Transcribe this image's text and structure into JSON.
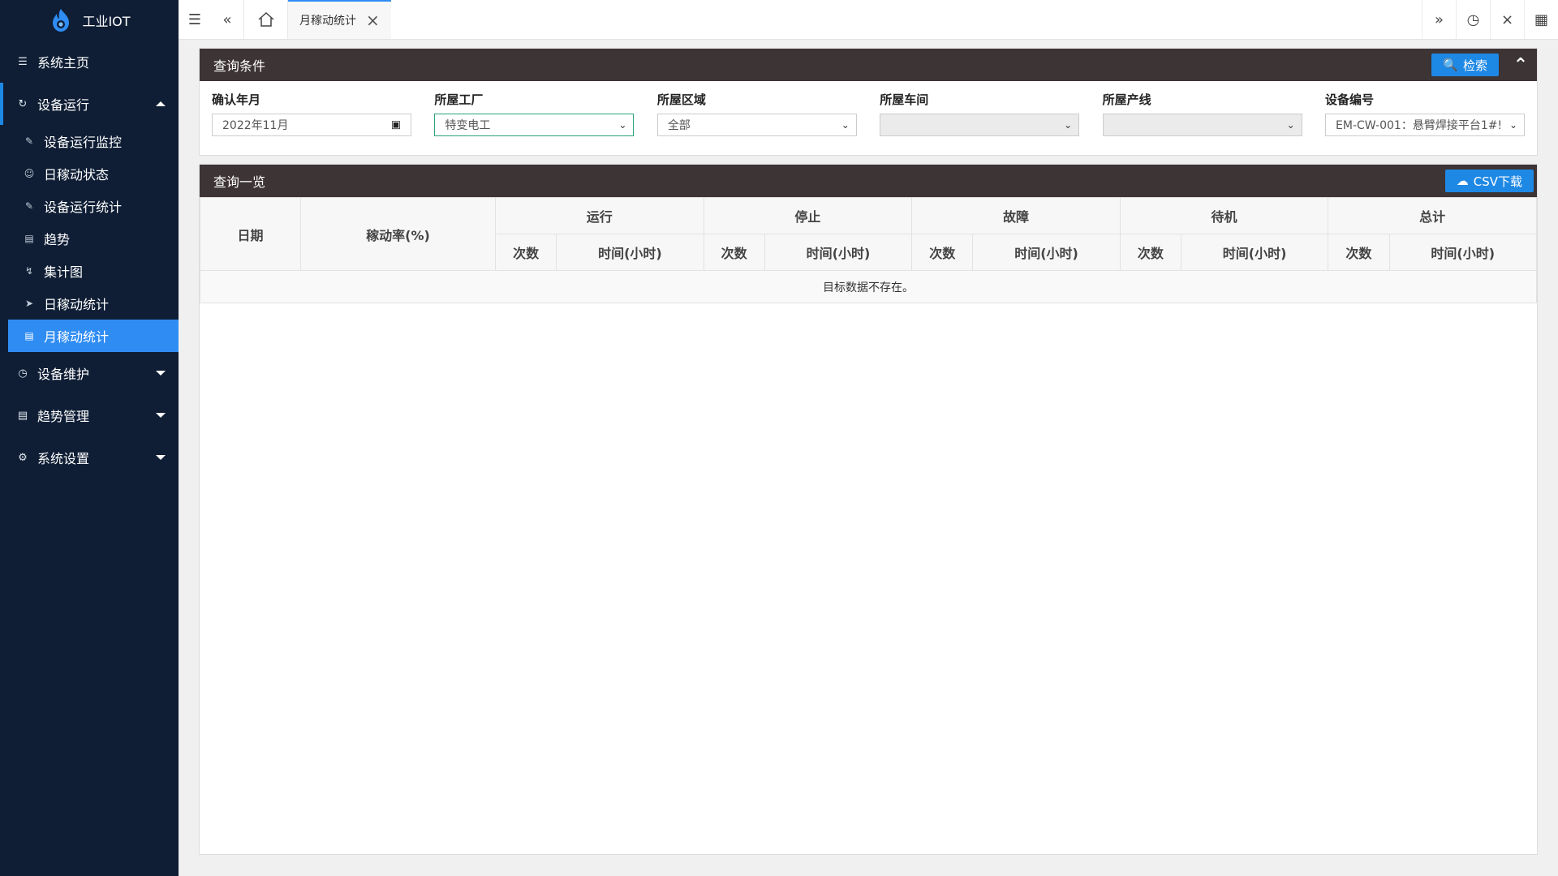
{
  "app": {
    "title": "工业IOT"
  },
  "sidebar": {
    "home": {
      "label": "系统主页",
      "icon": "layers-icon"
    },
    "operation": {
      "label": "设备运行",
      "icon": "refresh-icon",
      "children": [
        {
          "label": "设备运行监控",
          "icon": "edit-doc-icon"
        },
        {
          "label": "日稼动状态",
          "icon": "smile-icon"
        },
        {
          "label": "设备运行统计",
          "icon": "edit-doc-icon"
        },
        {
          "label": "趋势",
          "icon": "doc-icon"
        },
        {
          "label": "集计图",
          "icon": "pulse-icon"
        },
        {
          "label": "日稼动统计",
          "icon": "send-icon"
        },
        {
          "label": "月稼动统计",
          "icon": "doc-icon",
          "active": true
        }
      ]
    },
    "maintenance": {
      "label": "设备维护",
      "icon": "clock-icon"
    },
    "trend_mgmt": {
      "label": "趋势管理",
      "icon": "doc-icon"
    },
    "settings": {
      "label": "系统设置",
      "icon": "gear-icon"
    }
  },
  "topbar": {
    "active_tab": "月稼动统计"
  },
  "query": {
    "title": "查询条件",
    "search_label": "检索",
    "fields": {
      "month": {
        "label": "确认年月",
        "value": "2022年11月"
      },
      "factory": {
        "label": "所屋工厂",
        "value": "特变电工"
      },
      "area": {
        "label": "所屋区域",
        "value": "全部"
      },
      "workshop": {
        "label": "所屋车间",
        "value": ""
      },
      "line": {
        "label": "所屋产线",
        "value": ""
      },
      "device": {
        "label": "设备编号",
        "value": "EM-CW-001：悬臂焊接平台1#!"
      }
    }
  },
  "results": {
    "title": "查询一览",
    "csv_label": "CSV下载",
    "headers": {
      "date": "日期",
      "rate": "稼动率(%)",
      "groups": [
        "运行",
        "停止",
        "故障",
        "待机",
        "总计"
      ],
      "count": "次数",
      "time": "时间(小时)"
    },
    "empty_message": "目标数据不存在。"
  },
  "colors": {
    "sidebar_bg": "#0f1e35",
    "accent": "#1e88e5",
    "panel_header": "#3d3435"
  }
}
